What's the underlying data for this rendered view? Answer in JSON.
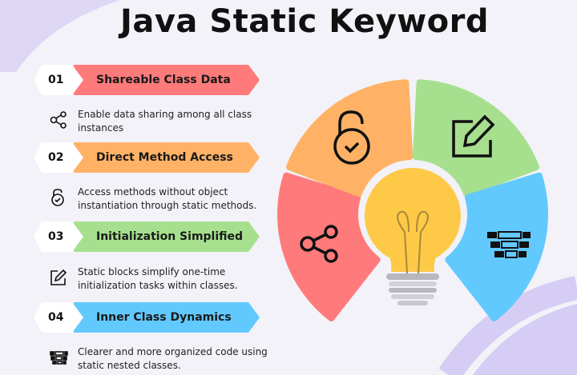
{
  "title": "Java Static Keyword",
  "items": [
    {
      "num": "01",
      "label": "Shareable Class Data",
      "desc": "Enable data sharing among all class instances",
      "color": "#ff7a7a",
      "icon": "share-icon"
    },
    {
      "num": "02",
      "label": "Direct Method Access",
      "desc": "Access methods without object instantiation through static methods.",
      "color": "#ffb266",
      "icon": "unlock-check-icon"
    },
    {
      "num": "03",
      "label": "Initialization Simplified",
      "desc": "Static blocks simplify one-time initialization tasks within classes.",
      "color": "#a6e08e",
      "icon": "edit-icon"
    },
    {
      "num": "04",
      "label": "Inner Class Dynamics",
      "desc": "Clearer and more organized code using static nested classes.",
      "color": "#62c9ff",
      "icon": "nested-blocks-icon"
    }
  ],
  "colors": {
    "bulb": "#fdc947",
    "base": "#b7b7be",
    "decor": "#d6cdf5"
  }
}
